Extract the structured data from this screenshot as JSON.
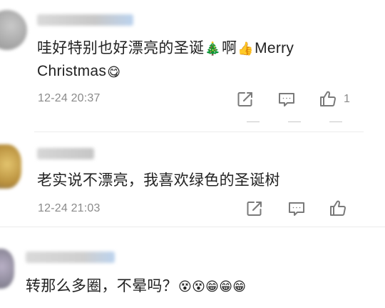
{
  "comments": [
    {
      "text": "哇好特别也好漂亮的圣诞",
      "emoji_a": "🎄",
      "text_b": "啊",
      "emoji_b": "👍",
      "text_c": "Merry",
      "text_line2": "Christmas",
      "emoji_c": "😋",
      "timestamp": "12-24 20:37",
      "like_count": "1"
    },
    {
      "text": "老实说不漂亮，我喜欢绿色的圣诞树",
      "timestamp": "12-24 21:03"
    },
    {
      "text": "转那么多圈，不晕吗？",
      "emojis": "😵😵😁😁😁"
    }
  ],
  "colors": {
    "text": "#222222",
    "meta": "#8a8a8a",
    "icon": "#7a7a7a",
    "divider": "#ececec"
  },
  "icons": [
    "share-icon",
    "comment-icon",
    "like-icon"
  ]
}
